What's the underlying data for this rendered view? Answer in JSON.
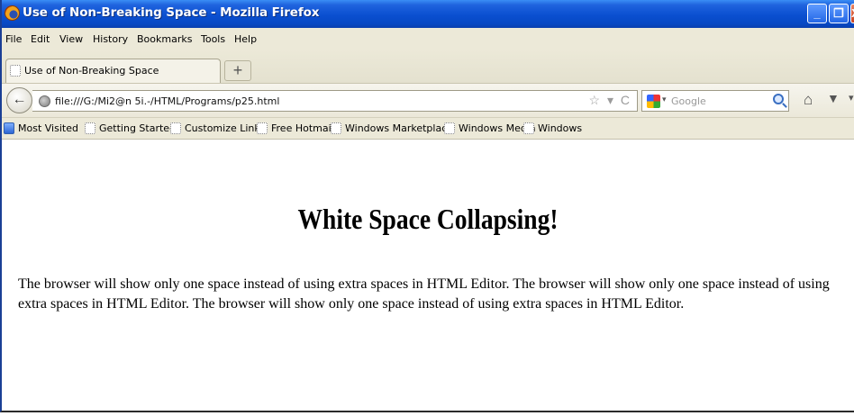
{
  "window": {
    "title": "Use of Non-Breaking Space - Mozilla Firefox",
    "controls": {
      "minimize": "_",
      "maximize": "❐",
      "close": "X"
    }
  },
  "menu": [
    {
      "key": "file",
      "label": "File"
    },
    {
      "key": "edit",
      "label": "Edit"
    },
    {
      "key": "view",
      "label": "View"
    },
    {
      "key": "history",
      "label": "History"
    },
    {
      "key": "bookmarks",
      "label": "Bookmarks"
    },
    {
      "key": "tools",
      "label": "Tools"
    },
    {
      "key": "help",
      "label": "Help"
    }
  ],
  "tabs": [
    {
      "label": "Use of Non-Breaking Space"
    }
  ],
  "new_tab_symbol": "+",
  "navigation": {
    "back_symbol": "←",
    "url": "file:///G:/Mi2@n 5i.-/HTML/Programs/p25.html",
    "url_icons": {
      "star": "☆",
      "dropdown": "▾",
      "reload": "C"
    },
    "search_placeholder": "Google",
    "search_dropdown": "▾",
    "home_symbol": "⌂",
    "pocket_symbol": "▼",
    "menu_symbol": "▾"
  },
  "bookmarks_bar": [
    {
      "label": "Most Visited",
      "icon": "most-visited-icon"
    },
    {
      "label": "Getting Started",
      "icon": "page-icon"
    },
    {
      "label": "Customize Links",
      "icon": "page-icon"
    },
    {
      "label": "Free Hotmail",
      "icon": "page-icon"
    },
    {
      "label": "Windows Marketplace",
      "icon": "page-icon"
    },
    {
      "label": "Windows Media",
      "icon": "page-icon"
    },
    {
      "label": "Windows",
      "icon": "page-icon"
    }
  ],
  "page": {
    "heading": "White Space Collapsing!",
    "paragraph": "The browser will show only one space instead of using extra spaces in HTML Editor. The browser will show only one space instead of using extra spaces in HTML Editor. The browser will show only one space instead of using extra spaces in HTML Editor."
  },
  "colors": {
    "titlebar": "#0a4fd0",
    "chrome": "#ece9d8",
    "content_background": "#ffffff"
  }
}
